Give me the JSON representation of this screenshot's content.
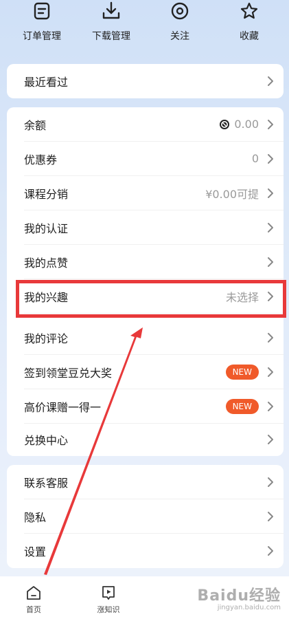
{
  "quick_actions": [
    {
      "label": "订单管理",
      "icon": "order-icon"
    },
    {
      "label": "下载管理",
      "icon": "download-icon"
    },
    {
      "label": "关注",
      "icon": "eye-icon"
    },
    {
      "label": "收藏",
      "icon": "star-icon"
    }
  ],
  "recent": {
    "label": "最近看过"
  },
  "account": [
    {
      "label": "余额",
      "value": "0.00",
      "icon": "coin-icon"
    },
    {
      "label": "优惠券",
      "value": "0"
    },
    {
      "label": "课程分销",
      "value": "¥0.00可提"
    },
    {
      "label": "我的认证",
      "value": ""
    },
    {
      "label": "我的点赞",
      "value": ""
    },
    {
      "label": "我的兴趣",
      "value": "未选择"
    }
  ],
  "activities": [
    {
      "label": "我的评论",
      "badge": ""
    },
    {
      "label": "签到领堂豆兑大奖",
      "badge": "NEW"
    },
    {
      "label": "高价课赠一得一",
      "badge": "NEW"
    },
    {
      "label": "兑换中心",
      "badge": ""
    }
  ],
  "support": [
    {
      "label": "联系客服"
    },
    {
      "label": "隐私"
    },
    {
      "label": "设置"
    }
  ],
  "bottom_nav": [
    {
      "label": "首页",
      "icon": "home-icon"
    },
    {
      "label": "涨知识",
      "icon": "play-icon"
    }
  ],
  "watermark": {
    "main": "Baidu经验",
    "sub": "jingyan.baidu.com"
  },
  "colors": {
    "accent_red": "#e8393a",
    "badge": "#f05a2a",
    "muted": "#9a9a9a"
  }
}
